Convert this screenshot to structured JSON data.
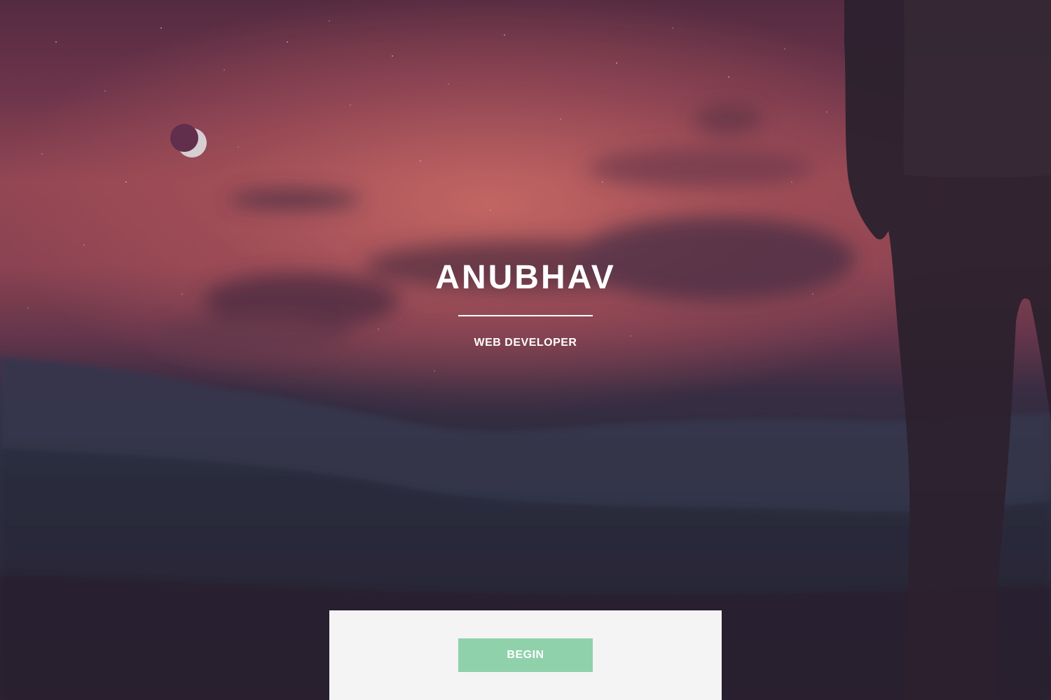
{
  "hero": {
    "title": "ANUBHAV",
    "subtitle": "WEB DEVELOPER",
    "background_image": "night-sky-mountains-silhouette-photo"
  },
  "action": {
    "begin_label": "BEGIN"
  },
  "colors": {
    "text": "#ffffff",
    "button": "#8fd1ab",
    "panel": "#f4f4f4",
    "sky_red": "#c25b5f",
    "mountains": "#2f3143"
  }
}
